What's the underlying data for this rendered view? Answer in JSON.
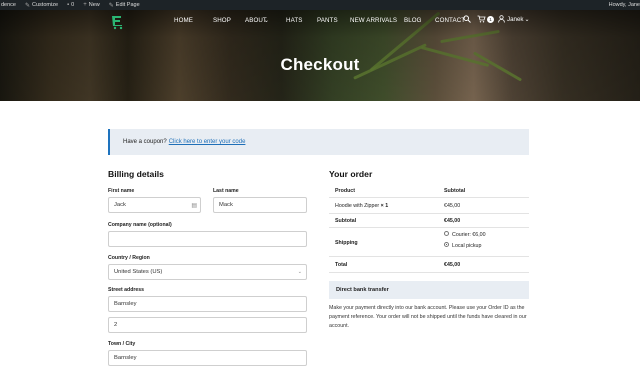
{
  "adminbar": {
    "site": "dence",
    "customize": "Customize",
    "comments": "0",
    "new": "New",
    "edit": "Edit Page",
    "howdy": "Howdy, Jane"
  },
  "nav": {
    "items": [
      "HOME",
      "SHOP",
      "ABOUT",
      "HATS",
      "PANTS",
      "NEW ARRIVALS",
      "BLOG",
      "CONTACT"
    ],
    "cart_count": "1",
    "user": "Janek"
  },
  "page_title": "Checkout",
  "coupon": {
    "text": "Have a coupon?",
    "link": "Click here to enter your code"
  },
  "billing": {
    "heading": "Billing details",
    "first_name_label": "First name",
    "first_name": "Jack",
    "last_name_label": "Last name",
    "last_name": "Mack",
    "company_label": "Company name (optional)",
    "company": "",
    "country_label": "Country / Region",
    "country": "United States (US)",
    "street_label": "Street address",
    "street1": "Barnsley",
    "street2": "2",
    "city_label": "Town / City",
    "city": "Barnsley"
  },
  "order": {
    "heading": "Your order",
    "col_product": "Product",
    "col_subtotal": "Subtotal",
    "item_name": "Hoodie with Zipper",
    "item_qty": "× 1",
    "item_total": "€45,00",
    "subtotal_label": "Subtotal",
    "subtotal": "€45,00",
    "shipping_label": "Shipping",
    "ship_opt1": "Courier: €6,00",
    "ship_opt2": "Local pickup",
    "total_label": "Total",
    "total": "€45,00"
  },
  "payment": {
    "method": "Direct bank transfer",
    "description": "Make your payment directly into our bank account. Please use your Order ID as the payment reference. Your order will not be shipped until the funds have cleared in our account."
  },
  "colors": {
    "admin_bar": "#1d2327",
    "accent": "#1e73be",
    "notice_bg": "#e8edf3",
    "logo": "#2bb673"
  }
}
